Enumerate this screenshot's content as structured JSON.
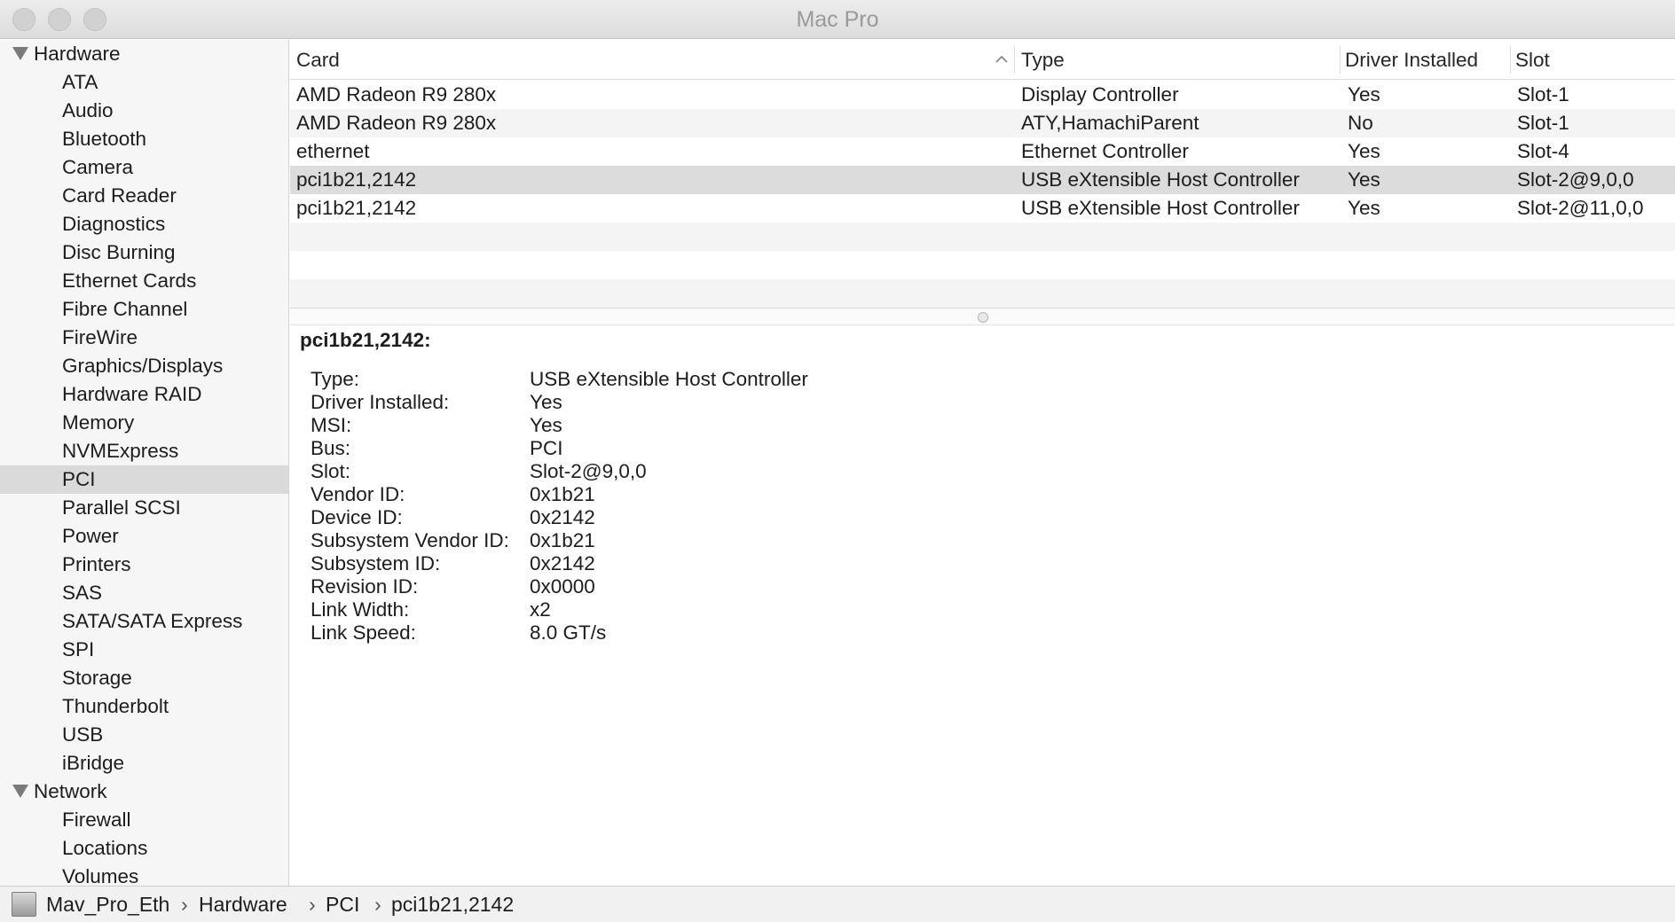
{
  "window": {
    "title": "Mac Pro"
  },
  "sidebar": {
    "sections": [
      {
        "label": "Hardware",
        "items": [
          "ATA",
          "Audio",
          "Bluetooth",
          "Camera",
          "Card Reader",
          "Diagnostics",
          "Disc Burning",
          "Ethernet Cards",
          "Fibre Channel",
          "FireWire",
          "Graphics/Displays",
          "Hardware RAID",
          "Memory",
          "NVMExpress",
          "PCI",
          "Parallel SCSI",
          "Power",
          "Printers",
          "SAS",
          "SATA/SATA Express",
          "SPI",
          "Storage",
          "Thunderbolt",
          "USB",
          "iBridge"
        ]
      },
      {
        "label": "Network",
        "items": [
          "Firewall",
          "Locations",
          "Volumes"
        ]
      }
    ],
    "selected": "PCI"
  },
  "table": {
    "columns": [
      "Card",
      "Type",
      "Driver Installed",
      "Slot"
    ],
    "sort_column": "Card",
    "sort_direction": "ascending",
    "rows": [
      [
        "AMD Radeon R9 280x",
        "Display Controller",
        "Yes",
        "Slot-1"
      ],
      [
        "AMD Radeon R9 280x",
        "ATY,HamachiParent",
        "No",
        "Slot-1"
      ],
      [
        "ethernet",
        "Ethernet Controller",
        "Yes",
        "Slot-4"
      ],
      [
        "pci1b21,2142",
        "USB eXtensible Host Controller",
        "Yes",
        "Slot-2@9,0,0"
      ],
      [
        "pci1b21,2142",
        "USB eXtensible Host Controller",
        "Yes",
        "Slot-2@11,0,0"
      ]
    ],
    "selected_row": 3
  },
  "details": {
    "title": "pci1b21,2142:",
    "fields": [
      {
        "key": "Type:",
        "value": "USB eXtensible Host Controller"
      },
      {
        "key": "Driver Installed:",
        "value": "Yes"
      },
      {
        "key": "MSI:",
        "value": "Yes"
      },
      {
        "key": "Bus:",
        "value": "PCI"
      },
      {
        "key": "Slot:",
        "value": "Slot-2@9,0,0"
      },
      {
        "key": "Vendor ID:",
        "value": "0x1b21"
      },
      {
        "key": "Device ID:",
        "value": "0x2142"
      },
      {
        "key": "Subsystem Vendor ID:",
        "value": "0x1b21"
      },
      {
        "key": "Subsystem ID:",
        "value": "0x2142"
      },
      {
        "key": "Revision ID:",
        "value": "0x0000"
      },
      {
        "key": "Link Width:",
        "value": "x2"
      },
      {
        "key": "Link Speed:",
        "value": "8.0 GT/s"
      }
    ]
  },
  "pathbar": {
    "icon": "mac-pro-icon",
    "crumbs": [
      "Mav_Pro_Eth",
      "Hardware",
      "PCI",
      "pci1b21,2142"
    ]
  }
}
